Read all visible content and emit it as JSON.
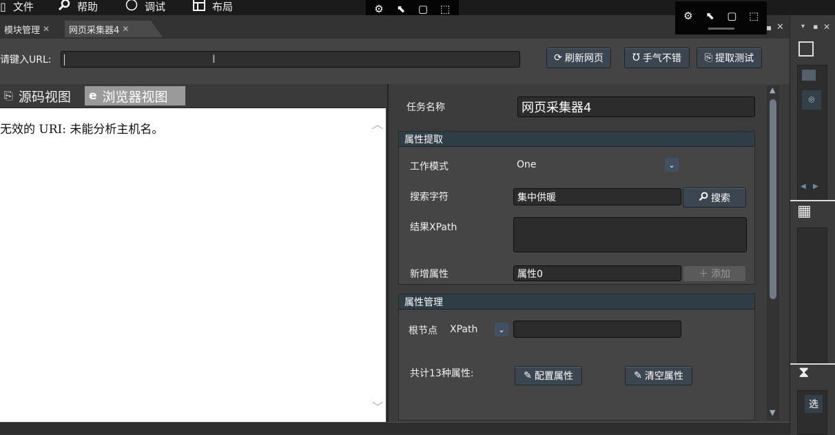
{
  "menu": {
    "items": [
      {
        "label": "文件",
        "icon": "file-icon"
      },
      {
        "label": "帮助",
        "icon": "search-icon"
      },
      {
        "label": "调试",
        "icon": "circle-icon"
      },
      {
        "label": "布局",
        "icon": "layout-icon"
      }
    ]
  },
  "tabs": [
    {
      "label": "模块管理"
    },
    {
      "label": "网页采集器4"
    }
  ],
  "url_row": {
    "label": "请键入URL:",
    "input_value": "",
    "refresh_label": "刷新网页",
    "lucky_label": "手气不错",
    "extract_test_label": "提取测试"
  },
  "view_tabs": {
    "source_label": "源码视图",
    "browser_label": "浏览器视图"
  },
  "browser": {
    "error_text": "无效的 URI: 未能分析主机名。"
  },
  "task": {
    "name_label": "任务名称",
    "name_value": "网页采集器4"
  },
  "attr_extract": {
    "title": "属性提取",
    "mode_label": "工作模式",
    "mode_value": "One",
    "search_label": "搜索字符",
    "search_value": "集中供暖",
    "search_button": "搜索",
    "xpath_label": "结果XPath",
    "xpath_value": "",
    "new_attr_label": "新增属性",
    "new_attr_value": "属性0",
    "add_button": "添加"
  },
  "attr_manage": {
    "title": "属性管理",
    "root_label": "根节点",
    "root_mode": "XPath",
    "root_value": "",
    "count_text": "共计13种属性:",
    "config_button": "配置属性",
    "clear_button": "清空属性"
  },
  "dock": {
    "select_label": "选"
  },
  "colors": {
    "accent_button": "#3c4650",
    "group_header": "#2f3d47"
  }
}
